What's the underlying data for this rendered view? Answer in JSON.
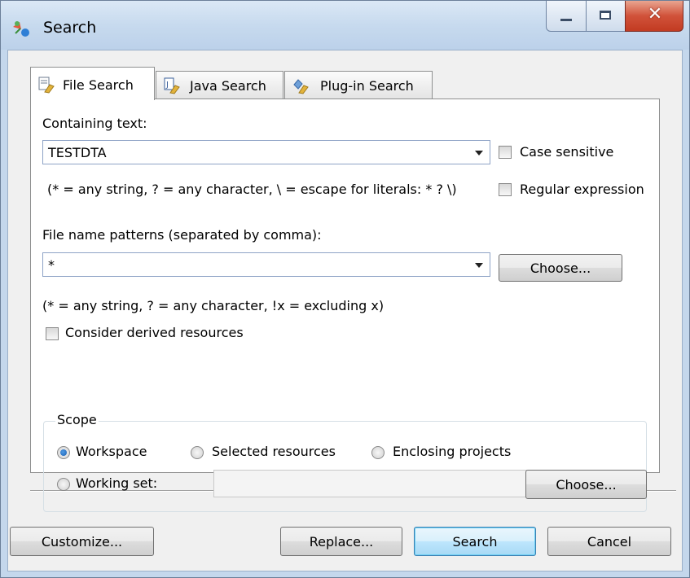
{
  "window": {
    "title": "Search"
  },
  "tabs": [
    {
      "label": "File Search",
      "active": true,
      "icon": "file-search-icon"
    },
    {
      "label": "Java Search",
      "active": false,
      "icon": "java-search-icon"
    },
    {
      "label": "Plug-in Search",
      "active": false,
      "icon": "plugin-search-icon"
    }
  ],
  "containing": {
    "label": "Containing text:",
    "value": "TESTDTA",
    "hint": "(* = any string, ? = any character, \\ = escape for literals: * ? \\)",
    "case_sensitive": "Case sensitive",
    "regex": "Regular expression"
  },
  "patterns": {
    "label": "File name patterns (separated by comma):",
    "value": "*",
    "choose": "Choose...",
    "hint": "(* = any string, ? = any character, !x = excluding x)",
    "derived": "Consider derived resources"
  },
  "scope": {
    "title": "Scope",
    "workspace": "Workspace",
    "selected": "Selected resources",
    "enclosing": "Enclosing projects",
    "working_set": "Working set:",
    "choose": "Choose...",
    "selected_option": "Workspace"
  },
  "footer": {
    "customize": "Customize...",
    "replace": "Replace...",
    "search": "Search",
    "cancel": "Cancel"
  },
  "colors": {
    "title_bar": "#c7daee",
    "close_button": "#c94a33",
    "default_button": "#bee6fd"
  }
}
